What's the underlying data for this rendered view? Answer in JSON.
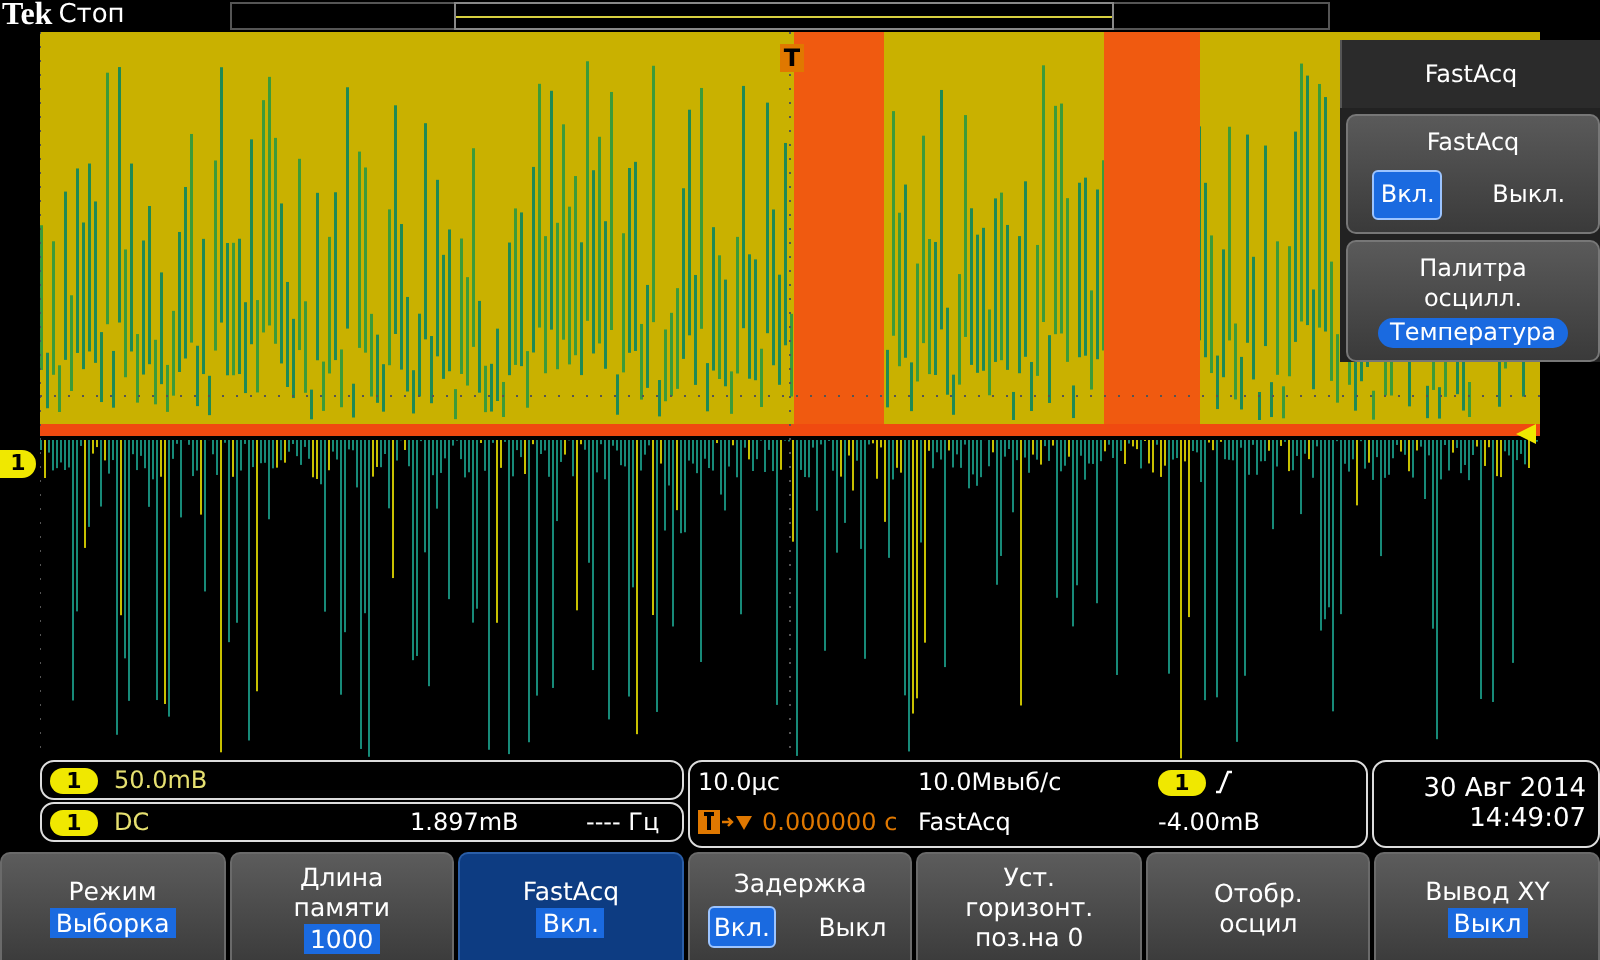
{
  "header": {
    "logo": "Tek",
    "status": "Стоп",
    "trigger_marker": "T"
  },
  "display": {
    "channel_marker": "1"
  },
  "side_menu": {
    "title": "FastAcq",
    "items": [
      {
        "kind": "toggle",
        "label": "FastAcq",
        "options": [
          {
            "label": "Вкл.",
            "selected": true
          },
          {
            "label": "Выкл.",
            "selected": false
          }
        ]
      },
      {
        "kind": "value",
        "label": "Палитра\nосцилл.",
        "value": "Температура"
      }
    ]
  },
  "channel_readout": {
    "scale_channel": "1",
    "scale": "50.0mB",
    "coupling_channel": "1",
    "coupling": "DC",
    "mean": "1.897mB",
    "frequency": "---- Гц"
  },
  "acquisition_readout": {
    "timebase": "10.0μс",
    "sample_rate": "10.0Мвыб/с",
    "trigger_channel": "1",
    "trigger_position": "0.000000 с",
    "mode": "FastAcq",
    "trigger_level": "-4.00mB"
  },
  "datetime": {
    "date": "30 Авг 2014",
    "time": "14:49:07"
  },
  "bottom_menu": [
    {
      "kind": "value",
      "label": "Режим",
      "value": "Выборка",
      "selected": false
    },
    {
      "kind": "value",
      "label": "Длина\nпамяти",
      "value": "1000",
      "selected": false
    },
    {
      "kind": "value",
      "label": "FastAcq",
      "value": "Вкл.",
      "selected": true
    },
    {
      "kind": "toggle",
      "label": "Задержка",
      "options": [
        {
          "label": "Вкл.",
          "selected": true
        },
        {
          "label": "Выкл",
          "selected": false
        }
      ],
      "selected": false
    },
    {
      "kind": "plain",
      "label": "Уст.\nгоризонт.\nпоз.на 0",
      "selected": false
    },
    {
      "kind": "plain",
      "label": "Отобр.\nосцил",
      "selected": false
    },
    {
      "kind": "value",
      "label": "Вывод XY",
      "value": "Выкл",
      "selected": false
    }
  ]
}
